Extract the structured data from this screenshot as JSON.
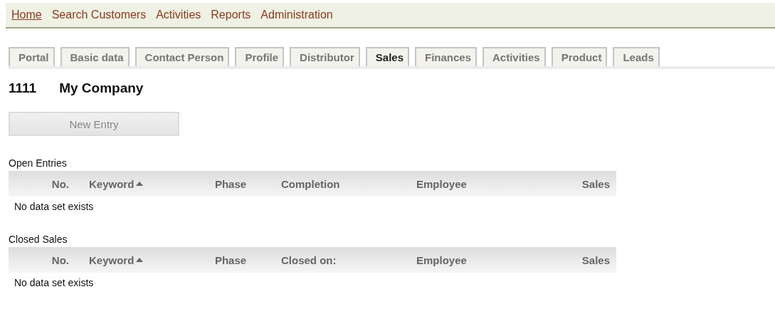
{
  "nav": [
    {
      "label": "Home",
      "selected": true
    },
    {
      "label": "Search Customers",
      "selected": false
    },
    {
      "label": "Activities",
      "selected": false
    },
    {
      "label": "Reports",
      "selected": false
    },
    {
      "label": "Administration",
      "selected": false
    }
  ],
  "tabs": [
    {
      "label": "Portal",
      "selected": false
    },
    {
      "label": "Basic data",
      "selected": false
    },
    {
      "label": "Contact Person",
      "selected": false
    },
    {
      "label": "Profile",
      "selected": false
    },
    {
      "label": "Distributor",
      "selected": false
    },
    {
      "label": "Sales",
      "selected": true
    },
    {
      "label": "Finances",
      "selected": false
    },
    {
      "label": "Activities",
      "selected": false
    },
    {
      "label": "Product",
      "selected": false
    },
    {
      "label": "Leads",
      "selected": false
    }
  ],
  "company": {
    "number": "1111",
    "name": "My Company"
  },
  "new_entry_button": {
    "label": "New Entry",
    "disabled": true
  },
  "sections": [
    {
      "title": "Open Entries",
      "columns": [
        {
          "label": "No.",
          "sorted": false
        },
        {
          "label": "Keyword",
          "sorted": true
        },
        {
          "label": "Phase",
          "sorted": false
        },
        {
          "label": "Completion",
          "sorted": false
        },
        {
          "label": "Employee",
          "sorted": false
        },
        {
          "label": "Sales",
          "sorted": false
        }
      ],
      "empty_message": "No data set exists"
    },
    {
      "title": "Closed Sales",
      "columns": [
        {
          "label": "No.",
          "sorted": false
        },
        {
          "label": "Keyword",
          "sorted": true
        },
        {
          "label": "Phase",
          "sorted": false
        },
        {
          "label": "Closed on:",
          "sorted": false
        },
        {
          "label": "Employee",
          "sorted": false
        },
        {
          "label": "Sales",
          "sorted": false
        }
      ],
      "empty_message": "No data set exists"
    }
  ]
}
